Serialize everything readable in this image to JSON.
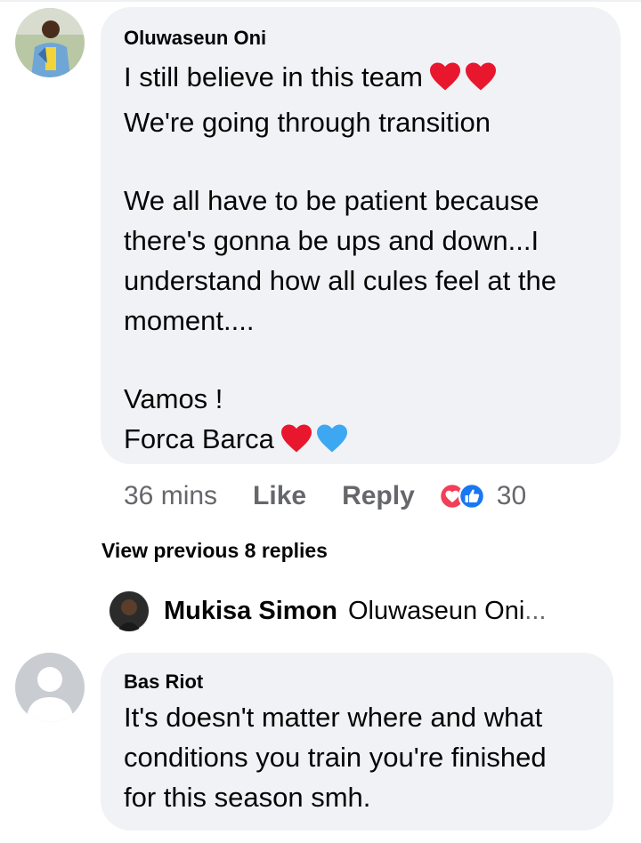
{
  "comment1": {
    "author": "Oluwaseun Oni",
    "lines": [
      "I still believe in this team",
      "We're going through transition",
      "",
      "We all have to be patient because",
      "there's gonna be ups and down...I",
      "understand how all cules feel at the",
      "moment....",
      "",
      "Vamos !",
      "Forca Barca"
    ],
    "time": "36 mins",
    "like_label": "Like",
    "reply_label": "Reply",
    "reaction_count": "30"
  },
  "replies": {
    "view_previous_label": "View previous 8 replies",
    "latest": {
      "author": "Mukisa Simon",
      "preview": "Oluwaseun Oni",
      "ellipsis": "..."
    }
  },
  "comment2": {
    "author": "Bas Riot",
    "lines": [
      "It's doesn't matter where and what",
      "conditions you train you're finished",
      "for this season smh."
    ]
  },
  "colors": {
    "bubble": "#f0f2f5",
    "meta": "#65676b",
    "heart_red": "#e8172e",
    "heart_blue": "#3ea7f2",
    "like_blue": "#1877f2"
  },
  "icons": [
    "red-heart-icon",
    "blue-heart-icon",
    "love-reaction-icon",
    "like-reaction-icon",
    "default-avatar-icon"
  ]
}
